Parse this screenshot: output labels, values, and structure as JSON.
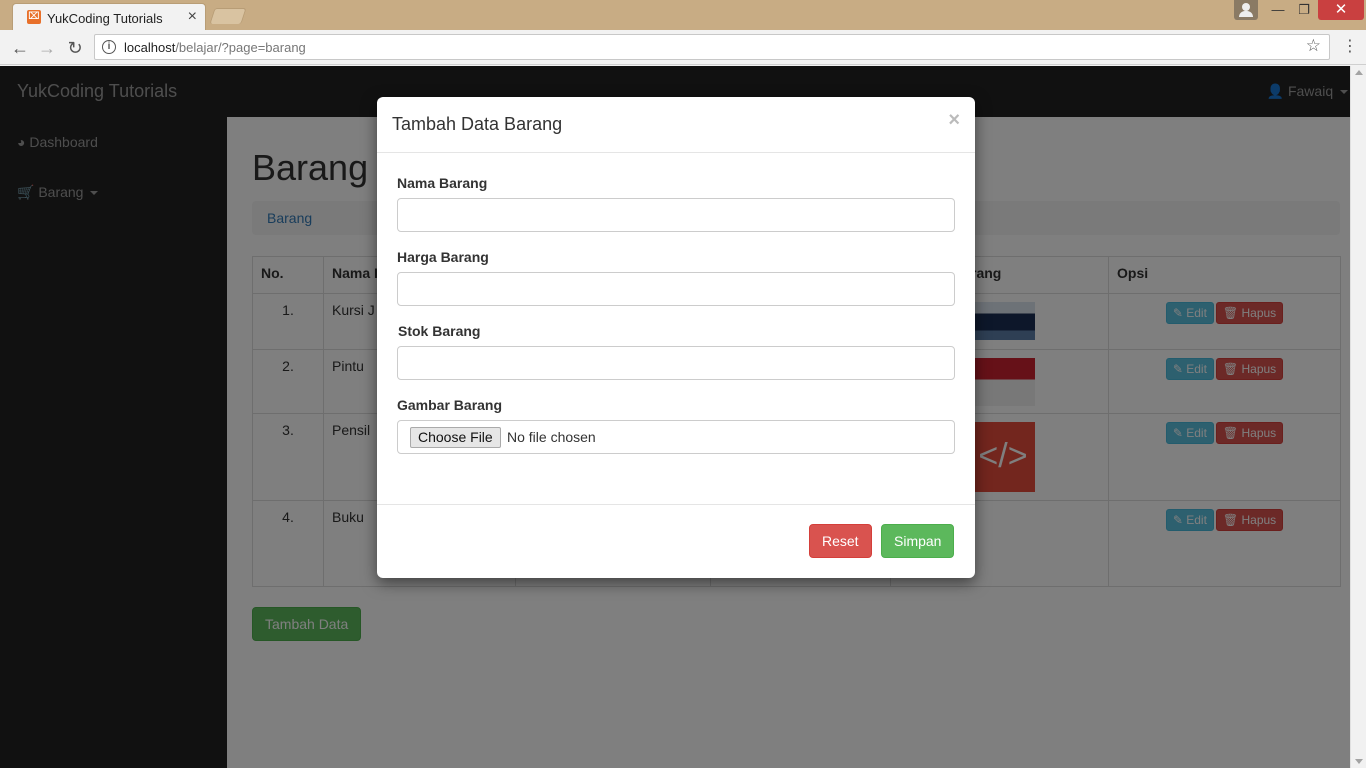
{
  "browser": {
    "tab_title": "YukCoding Tutorials",
    "url_host": "localhost",
    "url_path": "/belajar/?page=barang"
  },
  "app": {
    "brand": "YukCoding Tutorials",
    "user": "Fawaiq",
    "sidebar": [
      {
        "label": "Dashboard",
        "icon": "dashboard-icon"
      },
      {
        "label": "Barang",
        "icon": "cart-icon"
      }
    ]
  },
  "page": {
    "heading": "Barang",
    "breadcrumb": "Barang",
    "table": {
      "headers": [
        "No.",
        "Nama I",
        "",
        "",
        "rang",
        "Opsi"
      ],
      "rows": [
        {
          "no": "1.",
          "nama": "Kursi J"
        },
        {
          "no": "2.",
          "nama": "Pintu"
        },
        {
          "no": "3.",
          "nama": "Pensil"
        },
        {
          "no": "4.",
          "nama": "Buku"
        }
      ],
      "edit_label": "Edit",
      "hapus_label": "Hapus"
    },
    "add_button": "Tambah Data"
  },
  "modal": {
    "title": "Tambah Data Barang",
    "fields": {
      "nama": {
        "label": "Nama Barang",
        "value": ""
      },
      "harga": {
        "label": "Harga Barang",
        "value": ""
      },
      "stok": {
        "label": "Stok Barang",
        "value": ""
      },
      "gambar": {
        "label": "Gambar Barang",
        "button": "Choose File",
        "status": "No file chosen"
      }
    },
    "reset": "Reset",
    "simpan": "Simpan"
  },
  "colors": {
    "navbar": "#222222",
    "primary_link": "#337ab7",
    "success": "#5cb85c",
    "danger": "#d9534f",
    "info": "#5bc0de"
  }
}
